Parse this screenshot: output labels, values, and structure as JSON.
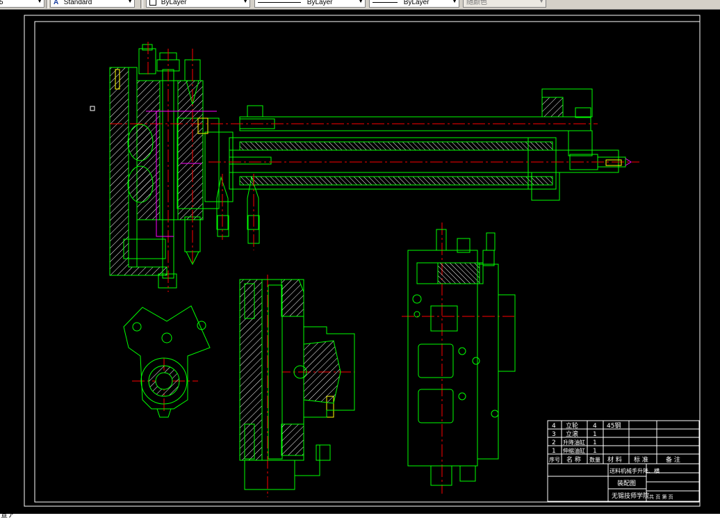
{
  "toolbar": {
    "first_value": "5",
    "text_style": "Standard",
    "layer": "ByLayer",
    "linetype": "ByLayer",
    "lineweight": "ByLayer",
    "plot_style": "随颜色"
  },
  "command_line": {
    "text": "宣ア"
  },
  "colors": {
    "background": "#000000",
    "green": "#00ff00",
    "white": "#ffffff",
    "red": "#ff0000",
    "yellow": "#ffff00",
    "magenta": "#ff00ff"
  },
  "bom": {
    "rows": [
      {
        "no": "4",
        "name": "立轮",
        "qty": "4",
        "material": "45钢",
        "spec": "",
        "note": ""
      },
      {
        "no": "3",
        "name": "立滚",
        "qty": "1",
        "material": "",
        "spec": "",
        "note": ""
      },
      {
        "no": "2",
        "name": "升降油缸",
        "qty": "1",
        "material": "",
        "spec": "",
        "note": ""
      },
      {
        "no": "1",
        "name": "伸缩油缸",
        "qty": "1",
        "material": "",
        "spec": "",
        "note": ""
      }
    ],
    "header": {
      "no": "序号",
      "name": "名 称",
      "qty": "数量",
      "material": "材 料",
      "spec": "标 准",
      "note": "备 注"
    }
  },
  "title_block": {
    "drawing_title": "送料机械手升降、横",
    "assembly_label": "装配图",
    "school": "无锡技师学院",
    "sheet_note": "共 页 第 页"
  }
}
